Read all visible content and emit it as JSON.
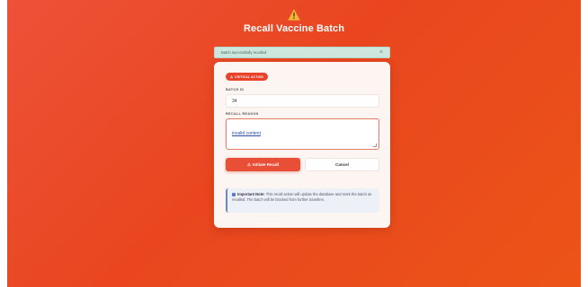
{
  "header": {
    "title": "Recall Vaccine Batch",
    "icon": "warning-icon"
  },
  "alert": {
    "message": "Batch successfully recalled",
    "close_label": "×"
  },
  "form": {
    "badge": "CRITICAL ACTION",
    "batch_id_label": "BATCH ID",
    "batch_id_value": "34",
    "reason_label": "RECALL REASON",
    "reason_value": "invalid content",
    "submit_label": "Initiate Recall",
    "cancel_label": "Cancel"
  },
  "note": {
    "title": "Important Note:",
    "body": "This recall action will update the database and mark the batch as recalled. The batch will be blocked from further transfers."
  },
  "colors": {
    "background": "#e9461f",
    "accent": "#e94e36",
    "alert_bg": "#cde7de",
    "note_border": "#6f86c7"
  }
}
